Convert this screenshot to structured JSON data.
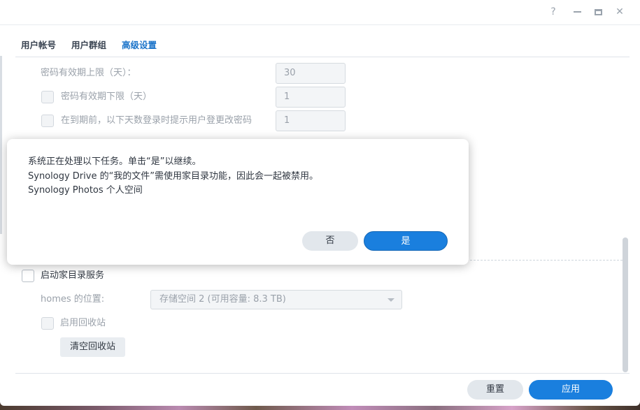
{
  "window": {
    "controls": {
      "help": "?",
      "close": "✕"
    }
  },
  "tabs": [
    {
      "label": "用户帐号",
      "active": false
    },
    {
      "label": "用户群组",
      "active": false
    },
    {
      "label": "高级设置",
      "active": true
    }
  ],
  "password_settings": {
    "max_age_label": "密码有效期上限（天）：",
    "max_age_value": "30",
    "min_age_label": "密码有效期下限（天）",
    "min_age_value": "1",
    "notify_label": "在到期前，以下天数登录时提示用户登更改密码",
    "notify_value": "1"
  },
  "home_service": {
    "enable_label": "启动家目录服务",
    "location_label": "homes 的位置:",
    "location_value": "存储空间 2 (可用容量:  8.3 TB)",
    "recycle_label": "启用回收站",
    "clear_recycle_label": "清空回收站"
  },
  "footer": {
    "reset_label": "重置",
    "apply_label": "应用"
  },
  "dialog": {
    "line1": "系统正在处理以下任务。单击“是”以继续。",
    "line2": "Synology Drive 的“我的文件”需使用家目录功能，因此会一起被禁用。",
    "line3": "Synology Photos 个人空间",
    "no_label": "否",
    "yes_label": "是"
  },
  "colors": {
    "accent": "#1a7fde",
    "active_tab": "#1a73c9",
    "muted_text": "#9aa1aa"
  }
}
